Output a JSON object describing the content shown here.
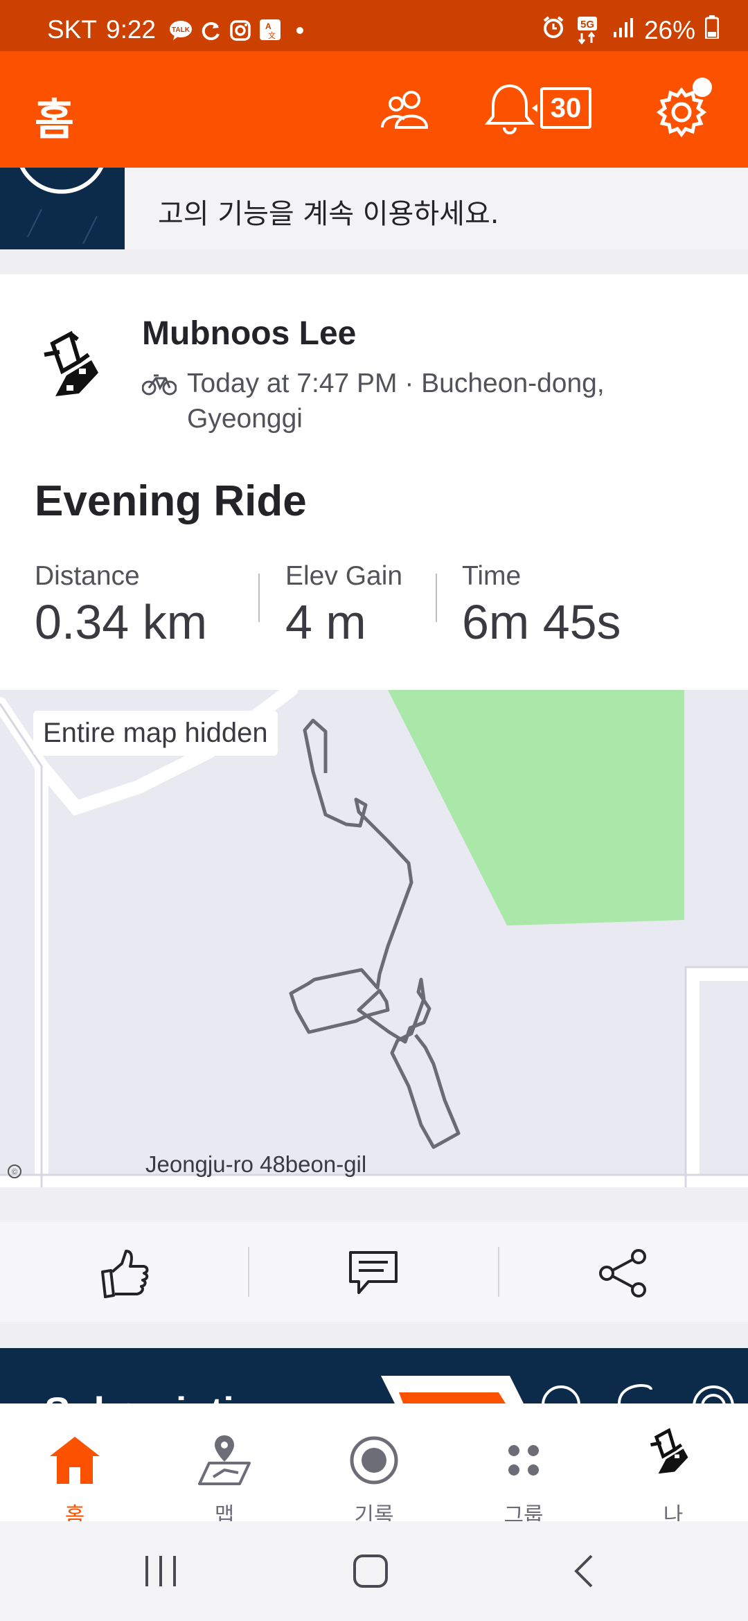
{
  "status_bar": {
    "carrier": "SKT",
    "time": "9:22",
    "battery": "26%",
    "network": "5G"
  },
  "header": {
    "title": "홈",
    "notification_count": "30"
  },
  "banner": {
    "line2": "고의 기능을 계속 이용하세요."
  },
  "activity": {
    "athlete_name": "Mubnoos Lee",
    "meta_line1": "Today at 7:47 PM · Bucheon-dong,",
    "meta_line2": "Gyeonggi",
    "title": "Evening Ride",
    "stats": [
      {
        "label": "Distance",
        "value": "0.34 km"
      },
      {
        "label": "Elev Gain",
        "value": "4 m"
      },
      {
        "label": "Time",
        "value": "6m 45s"
      }
    ],
    "map_badge": "Entire map hidden",
    "street_label": "Jeongju-ro 48beon-gil"
  },
  "subscription": {
    "title": "Subscription"
  },
  "bottom_nav": [
    {
      "label": "홈",
      "icon": "home-icon",
      "active": true
    },
    {
      "label": "맵",
      "icon": "map-icon"
    },
    {
      "label": "기록",
      "icon": "record-icon"
    },
    {
      "label": "그룹",
      "icon": "groups-icon"
    },
    {
      "label": "나",
      "icon": "profile-avatar"
    }
  ],
  "colors": {
    "brand": "#fc5200",
    "status_bar": "#cc4000",
    "route": "#6b6b75",
    "park": "#a9e8a8",
    "navy": "#0c2a4a"
  }
}
